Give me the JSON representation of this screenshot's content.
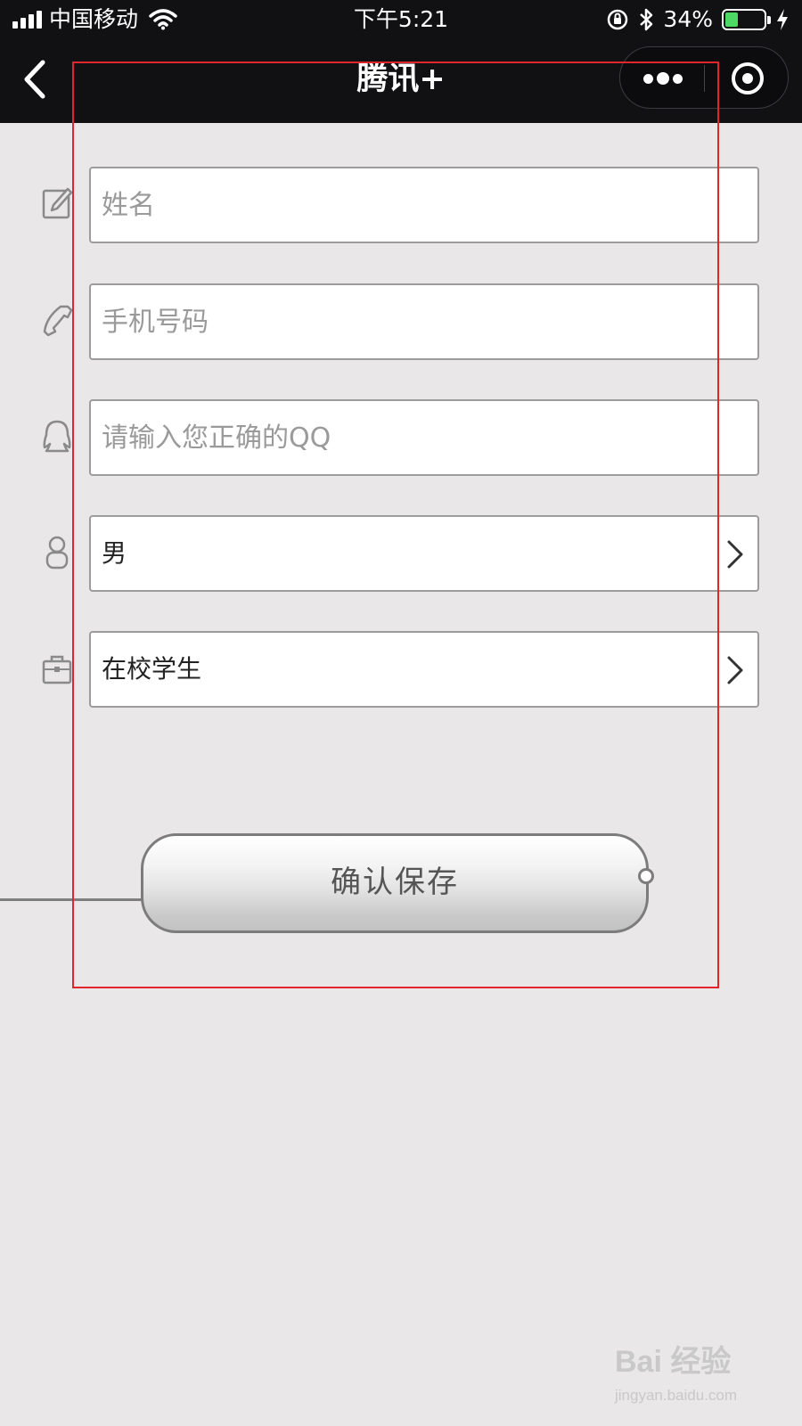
{
  "status_bar": {
    "carrier": "中国移动",
    "time": "下午5:21",
    "battery_percent": "34%",
    "battery_level": 0.34,
    "battery_color": "#4cd964"
  },
  "nav": {
    "title": "腾讯+",
    "back_icon": "chevron-left-icon",
    "more_icon": "more-dots-icon",
    "close_icon": "target-close-icon"
  },
  "form": {
    "name": {
      "placeholder": "姓名",
      "value": "",
      "icon": "edit-icon"
    },
    "phone": {
      "placeholder": "手机号码",
      "value": "",
      "icon": "phone-icon"
    },
    "qq": {
      "placeholder": "请输入您正确的QQ",
      "value": "",
      "icon": "qq-penguin-icon"
    },
    "gender": {
      "value": "男",
      "icon": "person-icon"
    },
    "occupation": {
      "value": "在校学生",
      "icon": "briefcase-icon"
    }
  },
  "save_button": {
    "label": "确认保存"
  },
  "watermark": {
    "brand": "Bai 经验",
    "url": "jingyan.baidu.com"
  },
  "colors": {
    "nav_background": "#111114",
    "page_background": "#e9e7e8",
    "annotation_frame": "#e0262c"
  }
}
